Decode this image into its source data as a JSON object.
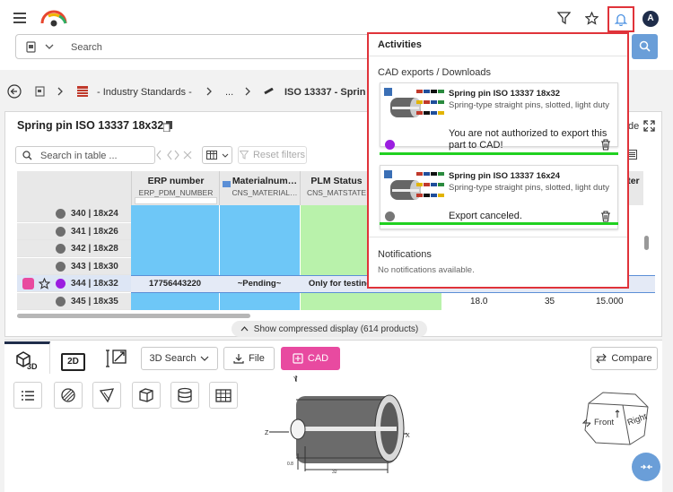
{
  "app": {
    "search_placeholder": "Search"
  },
  "breadcrumb": {
    "item1": "- Industry Standards -",
    "ellipsis": "...",
    "item3": "ISO 13337 - Sprin"
  },
  "part": {
    "title": "Spring pin ISO 13337 18x32"
  },
  "table": {
    "search_placeholder": "Search in table ...",
    "reset_filters": "Reset filters",
    "headers": [
      {
        "label": "ERP number",
        "sub": "ERP_PDM_NUMBER"
      },
      {
        "label": "Materialnum…",
        "sub": "CNS_MATERIAL…"
      },
      {
        "label": "PLM Status",
        "sub": "CNS_MATSTATE"
      },
      {
        "label": "eter"
      }
    ],
    "rows": [
      {
        "label": "340 | 18x24",
        "erp": "",
        "mat": "",
        "plm": "",
        "c1": "",
        "c2": "",
        "c3": ""
      },
      {
        "label": "341 | 18x26",
        "erp": "",
        "mat": "",
        "plm": "",
        "c1": "",
        "c2": "",
        "c3": ""
      },
      {
        "label": "342 | 18x28",
        "erp": "",
        "mat": "",
        "plm": "",
        "c1": "",
        "c2": "",
        "c3": ""
      },
      {
        "label": "343 | 18x30",
        "erp": "",
        "mat": "",
        "plm": "",
        "c1": "",
        "c2": "",
        "c3": ""
      },
      {
        "label": "344 | 18x32",
        "erp": "17756443220",
        "mat": "~Pending~",
        "plm": "Only for testing",
        "c1": "",
        "c2": "",
        "c3": ""
      },
      {
        "label": "345 | 18x35",
        "erp": "",
        "mat": "",
        "plm": "",
        "c1": "18.0",
        "c2": "35",
        "c3": "15.000"
      }
    ],
    "compressed": "Show compressed display (614 products)",
    "partial_label": "de"
  },
  "toolbar": {
    "tab_2d": "2D",
    "search3d": "3D Search",
    "file": "File",
    "cad": "CAD",
    "compare": "Compare"
  },
  "viewer": {
    "cube_front": "Front",
    "cube_right": "Right"
  },
  "activities": {
    "title": "Activities",
    "section": "CAD exports / Downloads",
    "items": [
      {
        "title": "Spring pin ISO 13337 18x32",
        "desc": "Spring-type straight pins, slotted, light duty",
        "message": "You are not authorized to export this part to CAD!",
        "status_color": "#9b1ee0"
      },
      {
        "title": "Spring pin ISO 13337 16x24",
        "desc": "Spring-type straight pins, slotted, light duty",
        "message": "Export canceled.",
        "status_color": "#777777"
      }
    ],
    "notifications_title": "Notifications",
    "notifications_empty": "No notifications available."
  },
  "colors": {
    "accent_pink": "#e84aa0",
    "blue_cell": "#6ec7f7",
    "green_cell": "#b9f2ab",
    "highlight_red": "#e0333a",
    "progress_green": "#21d121",
    "search_blue": "#6a9ed8"
  }
}
